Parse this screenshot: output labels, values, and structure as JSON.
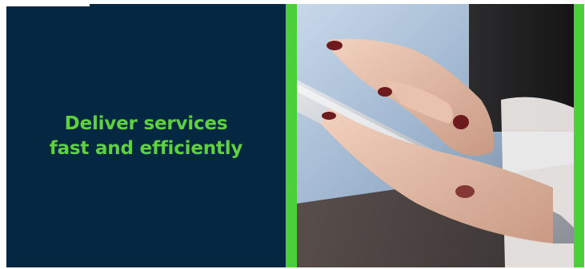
{
  "slide": {
    "headline_line1": "Deliver services",
    "headline_line2": "fast and efficiently"
  },
  "colors": {
    "panel_background": "#052842",
    "accent_green": "#5fd03f",
    "border_green": "#4bd03a"
  },
  "image": {
    "subject": "hand-tapping-tablet-photo"
  }
}
